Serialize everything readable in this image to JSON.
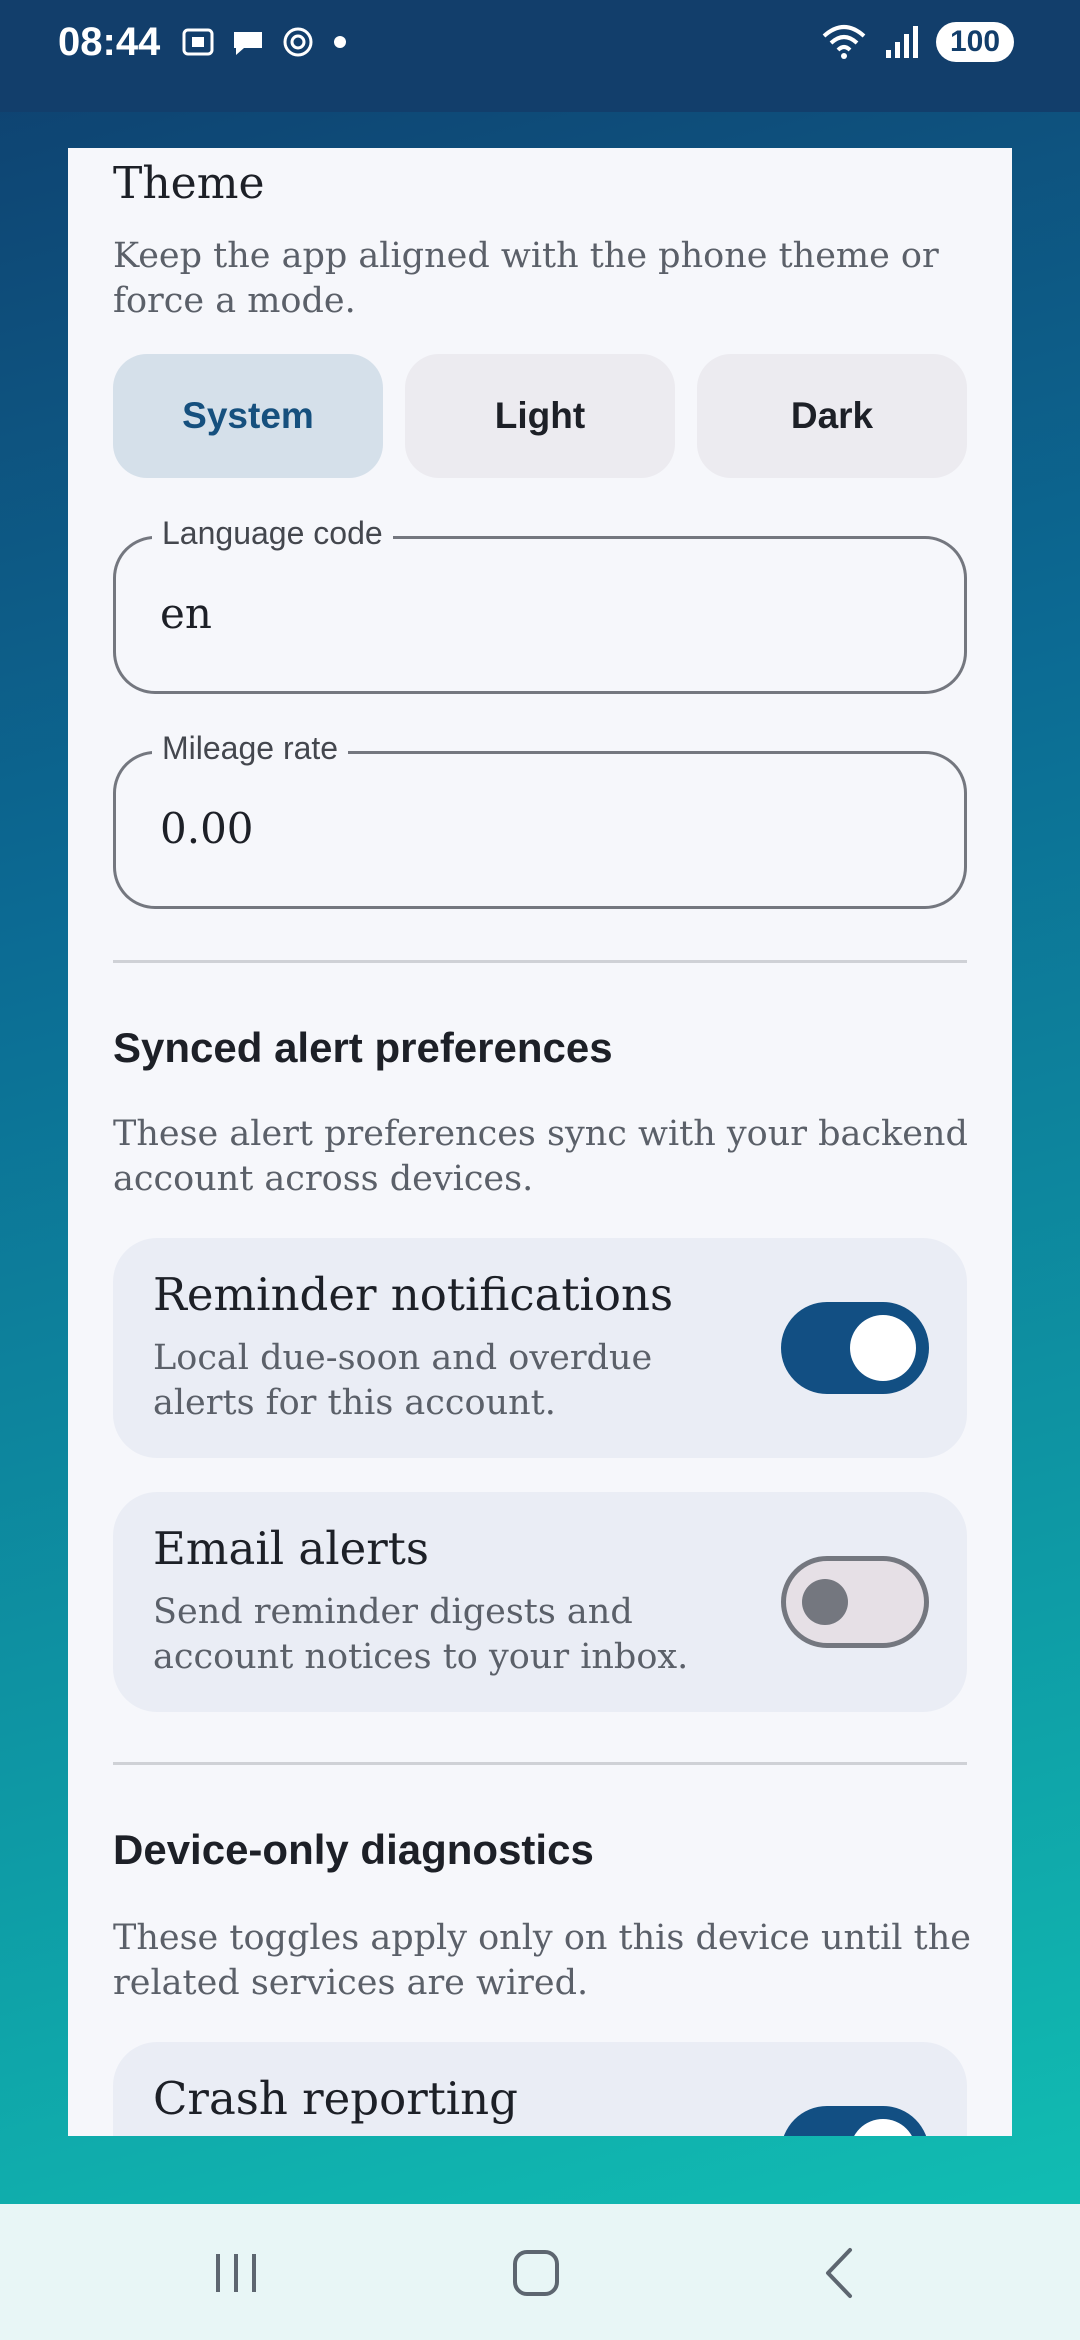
{
  "status_bar": {
    "time": "08:44",
    "left_icons": [
      "screenshot-icon",
      "chat-bubble-icon",
      "openai-icon",
      "dot-icon"
    ],
    "right_icons": [
      "wifi-icon",
      "signal-icon"
    ],
    "battery": "100"
  },
  "theme": {
    "title": "Theme",
    "description": "Keep the app aligned with the phone theme or force a mode.",
    "options": [
      "System",
      "Light",
      "Dark"
    ],
    "selected": "System"
  },
  "language_field": {
    "label": "Language code",
    "value": "en"
  },
  "mileage_field": {
    "label": "Mileage rate",
    "value": "0.00"
  },
  "synced_section": {
    "title": "Synced alert preferences",
    "description": "These alert preferences sync with your backend account across devices.",
    "items": [
      {
        "title": "Reminder notifications",
        "subtitle": "Local due-soon and overdue alerts for this account.",
        "enabled": true
      },
      {
        "title": "Email alerts",
        "subtitle": "Send reminder digests and account notices to your inbox.",
        "enabled": false
      }
    ]
  },
  "device_section": {
    "title": "Device-only diagnostics",
    "description": "These toggles apply only on this device until the related services are wired.",
    "items": [
      {
        "title": "Crash reporting",
        "enabled": true
      }
    ]
  },
  "colors": {
    "accent": "#124f83",
    "selected_segment": "#d5e0ea",
    "card_background": "#f6f7fb",
    "pref_background": "#eaedf5"
  },
  "nav_bar": {
    "buttons": [
      "recent-apps-icon",
      "home-icon",
      "back-icon"
    ]
  }
}
